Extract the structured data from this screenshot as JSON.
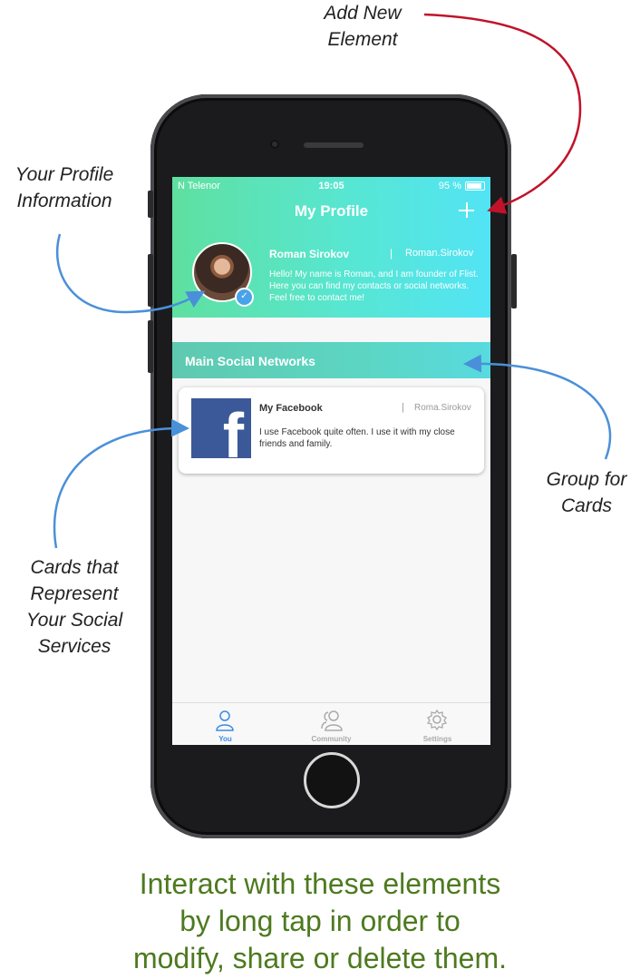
{
  "annotations": {
    "add_new": "Add New\nElement",
    "profile_info": "Your Profile\nInformation",
    "group_for_cards": "Group for\nCards",
    "cards": "Cards that\nRepresent\nYour Social\nServices"
  },
  "status_bar": {
    "carrier": "N Telenor",
    "time": "19:05",
    "battery": "95 %"
  },
  "nav": {
    "title": "My Profile",
    "add_icon": "plus-icon"
  },
  "profile": {
    "name": "Roman Sirokov",
    "separator": "|",
    "handle": "Roman.Sirokov",
    "bio": "Hello! My name is Roman, and I am founder of Flist. Here you can find my contacts or social networks. Feel free to contact me!",
    "verified_icon": "checkmark-icon"
  },
  "group": {
    "title": "Main Social Networks"
  },
  "cards": [
    {
      "icon": "facebook-logo",
      "title": "My Facebook",
      "separator": "|",
      "handle": "Roma.Sirokov",
      "description": "I use Facebook quite often. I use it with my close friends and family."
    }
  ],
  "tabs": [
    {
      "label": "You",
      "icon": "person-icon",
      "active": true
    },
    {
      "label": "Community",
      "icon": "people-icon",
      "active": false
    },
    {
      "label": "Settings",
      "icon": "gear-icon",
      "active": false
    }
  ],
  "footer_message": "Interact with these elements\nby long tap in order to\nmodify, share or delete them.",
  "colors": {
    "header_gradient_start": "#5fe0a0",
    "header_gradient_end": "#52e4f5",
    "active_tab": "#3a8be2",
    "facebook": "#3b5998",
    "annotation_red_arrow": "#c0132a",
    "annotation_blue_arrow": "#4a90d9",
    "footer_text": "#4d7a1f"
  }
}
